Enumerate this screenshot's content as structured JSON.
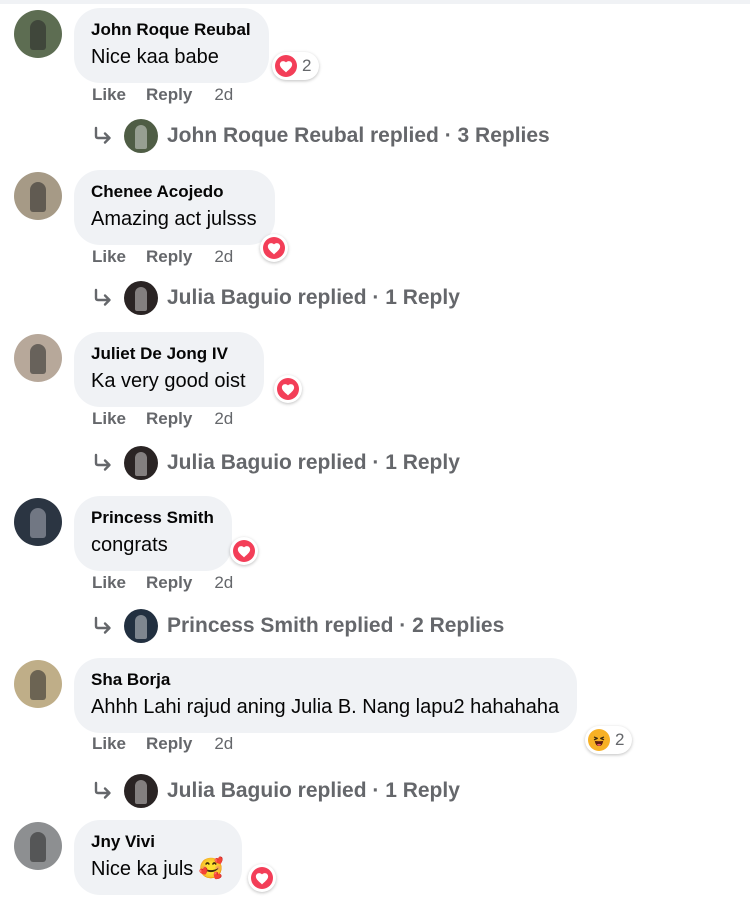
{
  "comments": [
    {
      "name": "John Roque Reubal",
      "text": "Nice kaa babe",
      "reaction": {
        "kind": "heart",
        "count": "2"
      },
      "like": "Like",
      "reply": "Reply",
      "time": "2d",
      "replies": {
        "name": "John Roque Reubal",
        "text": "John Roque Reubal replied · 3 Replies"
      }
    },
    {
      "name": "Chenee Acojedo",
      "text": "Amazing act julsss",
      "reaction": {
        "kind": "heart",
        "count": ""
      },
      "like": "Like",
      "reply": "Reply",
      "time": "2d",
      "replies": {
        "name": "Julia Baguio",
        "text": "Julia Baguio replied · 1 Reply"
      }
    },
    {
      "name": "Juliet De Jong IV",
      "text": "Ka very good oist",
      "reaction": {
        "kind": "heart",
        "count": ""
      },
      "like": "Like",
      "reply": "Reply",
      "time": "2d",
      "replies": {
        "name": "Julia Baguio",
        "text": "Julia Baguio replied · 1 Reply"
      }
    },
    {
      "name": "Princess Smith",
      "text": "congrats",
      "reaction": {
        "kind": "heart",
        "count": ""
      },
      "like": "Like",
      "reply": "Reply",
      "time": "2d",
      "replies": {
        "name": "Princess Smith",
        "text": "Princess Smith replied · 2 Replies"
      }
    },
    {
      "name": "Sha Borja",
      "text": "Ahhh Lahi rajud aning Julia B. Nang lapu2 hahahaha",
      "reaction": {
        "kind": "haha",
        "count": "2"
      },
      "like": "Like",
      "reply": "Reply",
      "time": "2d",
      "replies": {
        "name": "Julia Baguio",
        "text": "Julia Baguio replied · 1 Reply"
      }
    },
    {
      "name": "Jny Vivi",
      "text": "Nice ka juls 🥰",
      "reaction": {
        "kind": "heart",
        "count": ""
      }
    }
  ],
  "colors": {
    "bubble": "#f0f2f5",
    "secondary_text": "#65676b",
    "love": "#f33e58",
    "haha": "#f7b125"
  },
  "icons": {
    "reply_arrow": "reply-arrow-icon",
    "love": "love-reaction-icon",
    "haha": "haha-reaction-icon"
  }
}
